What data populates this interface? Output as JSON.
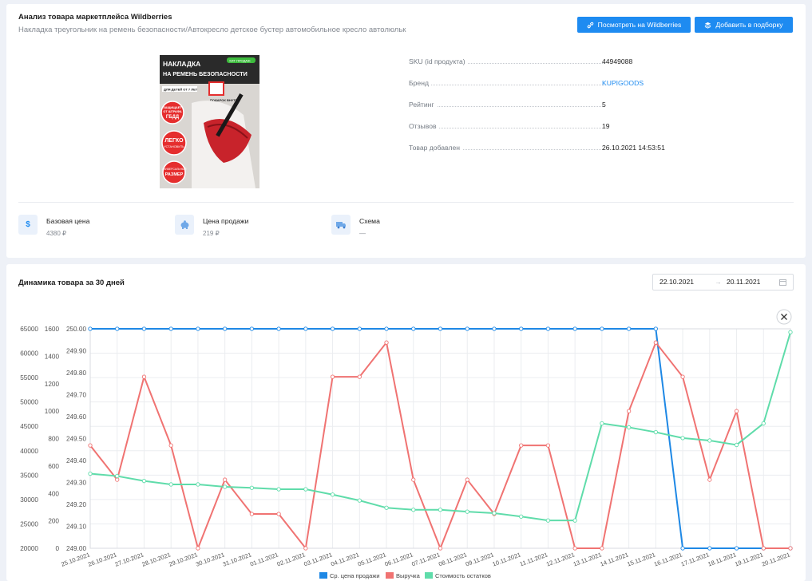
{
  "header": {
    "title": "Анализ товара маркетплейса Wildberries",
    "subtitle": "Накладка треугольник на ремень безопасности/Автокресло детское бустер автомобильное кресло автолюльк",
    "btn_view": "Посмотреть на Wildberries",
    "btn_add": "Добавить в подборку"
  },
  "product_image": {
    "line1": "НАКЛАДКА",
    "line2": "НА РЕМЕНЬ БЕЗОПАСНОСТИ",
    "hit": "ХИТ ПРОДАЖ",
    "age": "ДЛЯ ДЕТЕЙ ОТ 7 ЛЕТ",
    "gift": "ПОДАРОК ВНУТРИ",
    "b1a": "ЗАЩИЩАЕТ",
    "b1b": "ОТ ШТРАФА",
    "b1c": "ГБДД",
    "b2a": "ЛЕГКО",
    "b2b": "УСТАНОВИТЬ",
    "b3a": "УНИВЕРСАЛЬНЫЙ",
    "b3b": "РАЗМЕР"
  },
  "info": [
    {
      "label": "SKU (id продукта)",
      "value": "44949088"
    },
    {
      "label": "Бренд",
      "value": "KUPIGOODS"
    },
    {
      "label": "Рейтинг",
      "value": "5"
    },
    {
      "label": "Отзывов",
      "value": "19"
    },
    {
      "label": "Товар добавлен",
      "value": "26.10.2021 14:53:51"
    }
  ],
  "stats": [
    {
      "icon": "dollar-icon",
      "label": "Базовая цена",
      "value": "4380 ₽"
    },
    {
      "icon": "piggy-bank-icon",
      "label": "Цена продажи",
      "value": "219 ₽"
    },
    {
      "icon": "delivery-truck-icon",
      "label": "Схема",
      "value": "—"
    }
  ],
  "chart_section": {
    "title": "Динамика товара за 30 дней",
    "date_from": "22.10.2021",
    "date_to": "20.11.2021",
    "arrow": "→"
  },
  "colors": {
    "accent": "#1e8bf1",
    "series_price": "#1e88e5",
    "series_revenue": "#f07372",
    "series_stock": "#5fdcaa"
  },
  "chart_data": {
    "type": "line",
    "x": [
      "25.10.2021",
      "26.10.2021",
      "27.10.2021",
      "28.10.2021",
      "29.10.2021",
      "30.10.2021",
      "31.10.2021",
      "01.11.2021",
      "02.11.2021",
      "03.11.2021",
      "04.11.2021",
      "05.11.2021",
      "06.11.2021",
      "07.11.2021",
      "08.11.2021",
      "09.11.2021",
      "10.11.2021",
      "11.11.2021",
      "12.11.2021",
      "13.11.2021",
      "14.11.2021",
      "15.11.2021",
      "16.11.2021",
      "17.11.2021",
      "18.11.2021",
      "19.11.2021",
      "20.11.2021"
    ],
    "axes": {
      "left_outer": {
        "ticks": [
          "65000",
          "60000",
          "55000",
          "50000",
          "45000",
          "40000",
          "35000",
          "30000",
          "25000",
          "20000"
        ],
        "min": 20000,
        "max": 65000,
        "series": "Стоимость остатков"
      },
      "left_middle": {
        "ticks": [
          "1600",
          "1400",
          "1200",
          "1000",
          "800",
          "600",
          "400",
          "200",
          "0"
        ],
        "min": 0,
        "max": 1600,
        "series": "Выручка"
      },
      "left_inner": {
        "ticks": [
          "250.00",
          "249.90",
          "249.80",
          "249.70",
          "249.60",
          "249.50",
          "249.40",
          "249.30",
          "249.20",
          "249.10",
          "249.00"
        ],
        "min": 249.0,
        "max": 250.0,
        "series": "Ср. цена продажи"
      }
    },
    "series": [
      {
        "name": "Ср. цена продажи",
        "axis": "left_inner",
        "values": [
          250,
          250,
          250,
          250,
          250,
          250,
          250,
          250,
          250,
          250,
          250,
          250,
          250,
          250,
          250,
          250,
          250,
          250,
          250,
          250,
          250,
          250,
          249,
          249,
          249,
          249,
          249
        ]
      },
      {
        "name": "Выручка",
        "axis": "left_middle",
        "values": [
          750,
          500,
          1250,
          750,
          0,
          500,
          250,
          250,
          0,
          1250,
          1250,
          1500,
          500,
          0,
          500,
          250,
          750,
          750,
          0,
          0,
          1000,
          1500,
          1250,
          500,
          1000,
          0,
          0
        ]
      },
      {
        "name": "Стоимость остатков",
        "axis": "left_outer",
        "values": [
          35300,
          34800,
          33800,
          33100,
          33100,
          32600,
          32400,
          32100,
          32100,
          31000,
          29800,
          28300,
          27900,
          27900,
          27500,
          27200,
          26500,
          25700,
          25700,
          45600,
          44800,
          43800,
          42600,
          42100,
          41200,
          45600,
          64300
        ]
      }
    ],
    "legend_position": "bottom",
    "grid": true
  }
}
